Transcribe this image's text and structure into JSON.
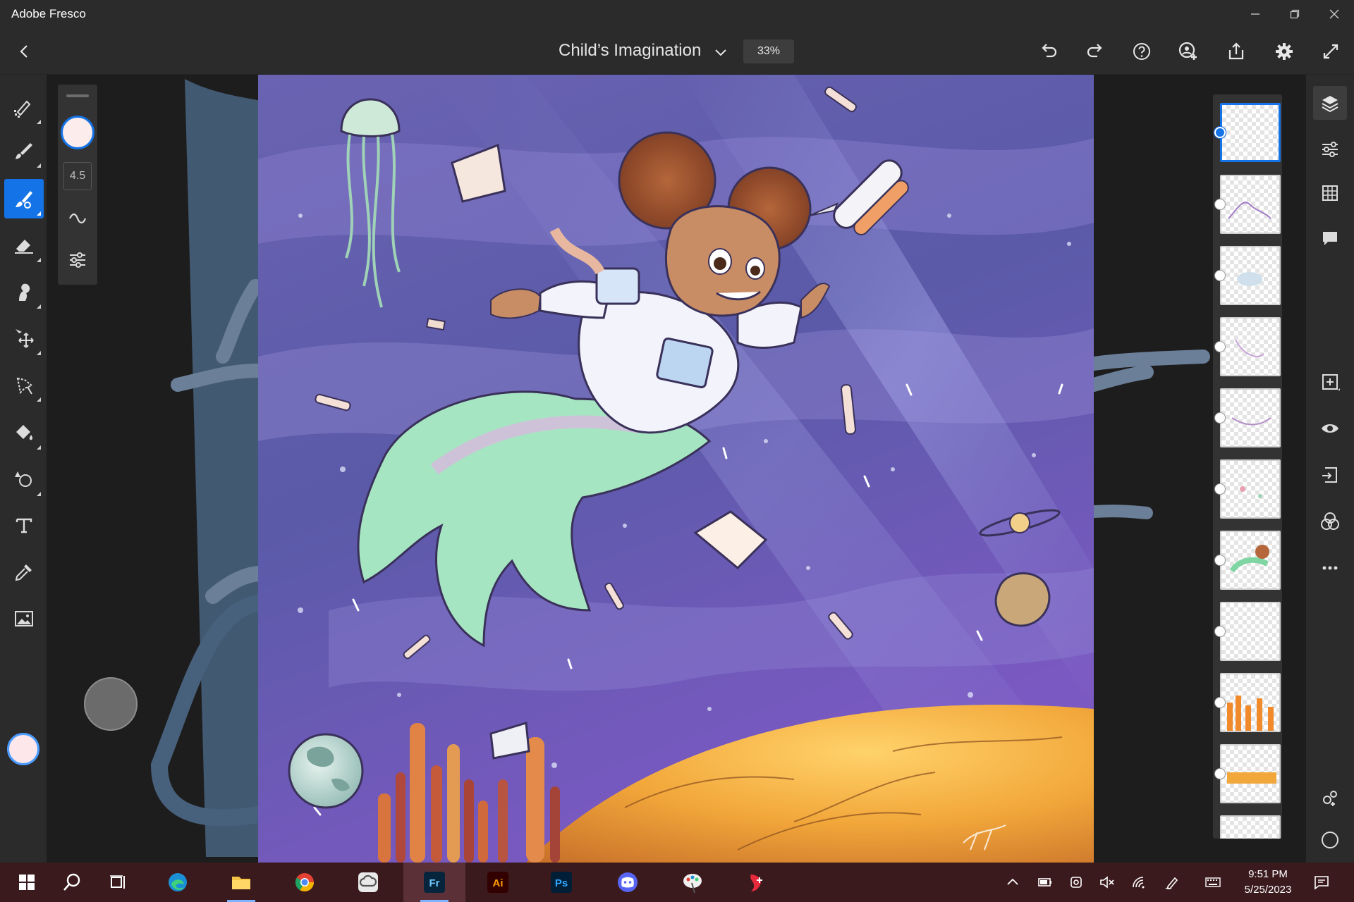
{
  "window": {
    "title": "Adobe Fresco"
  },
  "header": {
    "document_title": "Child’s Imagination",
    "zoom": "33%"
  },
  "brush": {
    "size": "4.5"
  },
  "colors": {
    "accent": "#1473e6",
    "current_color": "#fde7ea",
    "chrome": "#2b2b2b",
    "taskbar": "#3a1a1d"
  },
  "left_tools": [
    "pixel-brush-icon",
    "live-brush-icon",
    "vector-brush-icon",
    "eraser-icon",
    "smudge-icon",
    "move-icon",
    "lasso-icon",
    "fill-icon",
    "shapes-icon",
    "text-icon",
    "eyedropper-icon",
    "image-icon"
  ],
  "right_rail": [
    "layers-icon",
    "properties-icon",
    "grid-icon",
    "comment-icon",
    "add-layer-icon",
    "visibility-icon",
    "merge-down-icon",
    "blend-icon",
    "more-icon",
    "share-group-icon",
    "touch-icon"
  ],
  "layers": {
    "count_visible": 11,
    "selected_index": 0
  },
  "taskbar": {
    "apps": [
      "start",
      "search",
      "task-view",
      "edge",
      "file-explorer",
      "chrome",
      "creative-cloud",
      "fresco",
      "illustrator",
      "photoshop",
      "discord",
      "paint",
      "app-red"
    ],
    "fresco_label": "Fr",
    "illustrator_label": "Ai",
    "photoshop_label": "Ps",
    "time": "9:51 PM",
    "date": "5/25/2023"
  }
}
